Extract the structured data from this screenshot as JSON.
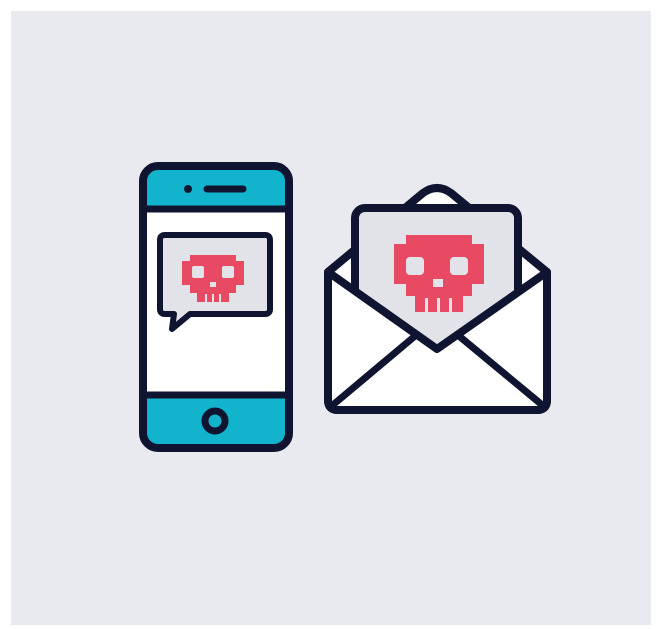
{
  "colors": {
    "page_background": "#ffffff",
    "card_background": "#e9eaf0",
    "outline": "#0f1430",
    "phone_accent": "#12b3cc",
    "phone_screen": "#ffffff",
    "bubble_fill": "#e2e3e8",
    "skull": "#e84a64",
    "skull_eye": "#e2e3e8",
    "envelope_fill": "#ffffff",
    "letter_fill": "#e2e3e8"
  },
  "icons": {
    "phone": "smartphone-icon",
    "message": "speech-bubble-icon",
    "message_skull": "skull-icon",
    "envelope": "open-envelope-icon",
    "letter_skull": "skull-icon"
  }
}
